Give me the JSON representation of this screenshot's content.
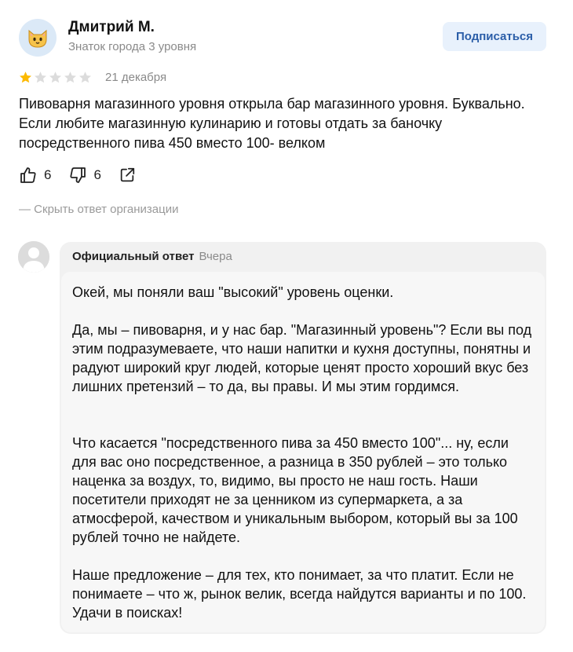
{
  "review": {
    "author_name": "Дмитрий М.",
    "author_level": "Знаток города 3 уровня",
    "subscribe_label": "Подписаться",
    "rating": 1,
    "rating_max": 5,
    "date": "21 декабря",
    "text": "Пивоварня магазинного уровня открыла бар магазинного уровня. Буквально. Если любите магазинную кулинарию и готовы отдать за баночку посредственного пива 450 вместо 100- велком",
    "likes": "6",
    "dislikes": "6",
    "hide_reply_label": "— Скрыть ответ организации"
  },
  "reply": {
    "label": "Официальный ответ",
    "date": "Вчера",
    "paragraphs": [
      "Окей, мы поняли ваш \"высокий\" уровень оценки.",
      "Да, мы – пивоварня, и у нас бар. \"Магазинный уровень\"? Если вы под этим подразумеваете, что наши напитки и кухня доступны, понятны и радуют широкий круг людей, которые ценят просто хороший вкус без лишних претензий – то да, вы правы. И мы этим гордимся.",
      "Что касается \"посредственного пива за 450 вместо 100\"... ну, если для вас оно посредственное, а разница в 350 рублей – это только наценка за воздух, то, видимо, вы просто не наш гость. Наши посетители приходят не за ценником из супермаркета, а за атмосферой, качеством и уникальным выбором, который вы за 100 рублей точно не найдете.",
      "Наше предложение – для тех, кто понимает, за что платит. Если не понимаете – что ж, рынок велик, всегда найдутся варианты и по 100. Удачи в поисках!"
    ]
  },
  "colors": {
    "star_filled": "#fcb900",
    "star_empty": "#dcdcdc",
    "subscribe_bg": "#e8f1fc",
    "subscribe_text": "#2b5ea8",
    "reply_bg": "#f1f1f1"
  },
  "icons": {
    "avatar": "cat-emoji-icon",
    "like": "thumbs-up-icon",
    "dislike": "thumbs-down-icon",
    "share": "share-icon",
    "org_avatar": "default-user-icon"
  }
}
